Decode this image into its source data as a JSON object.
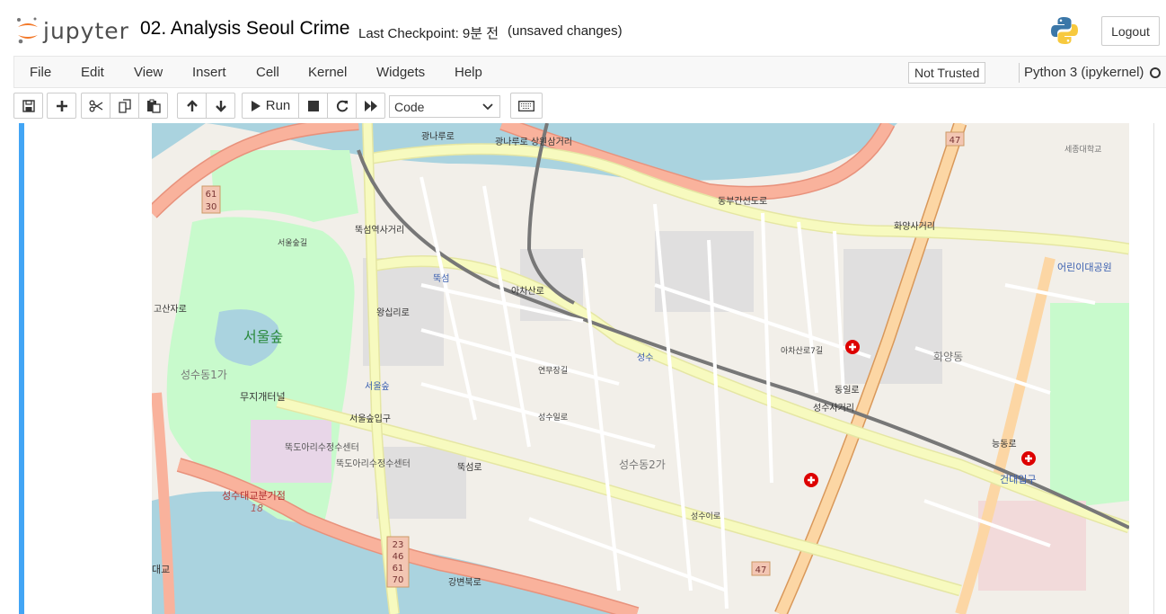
{
  "header": {
    "logo_text": "jupyter",
    "notebook_name": "02. Analysis Seoul Crime",
    "checkpoint": "Last Checkpoint: 9분 전",
    "autosave_status": "(unsaved changes)",
    "logout_label": "Logout"
  },
  "menubar": {
    "items": [
      "File",
      "Edit",
      "View",
      "Insert",
      "Cell",
      "Kernel",
      "Widgets",
      "Help"
    ],
    "trust_status": "Not Trusted",
    "kernel_name": "Python 3 (ipykernel)"
  },
  "toolbar": {
    "run_label": "Run",
    "cell_type": "Code",
    "cell_type_options": [
      "Code"
    ],
    "icons": [
      "save-icon",
      "plus-icon",
      "cut-icon",
      "copy-icon",
      "paste-icon",
      "arrow-up-icon",
      "arrow-down-icon",
      "play-icon",
      "stop-icon",
      "restart-icon",
      "fast-forward-icon",
      "keyboard-icon"
    ]
  },
  "colors": {
    "cell_selected_bar": "#42a5f5",
    "map_land": "#f2efe9",
    "map_water": "#aad3df",
    "map_park": "#c8facc",
    "map_primary_road": "#fcd6a4",
    "map_trunk_road": "#f9b29c",
    "map_secondary_road": "#f7fabf"
  },
  "map": {
    "place_labels": [
      "서울숲",
      "성수동1가",
      "성수동2가",
      "화양동",
      "뚝섬",
      "성수",
      "서울숲",
      "건대입구",
      "어린이대공원",
      "세종대학교",
      "뚝도아리수정수센터",
      "뚝도아리수정수센터",
      "성수대교분기점",
      "대교",
      "서울숲길",
      "무지개터널",
      "뚝섬역사거리",
      "서울숲입구",
      "화양사거리",
      "성수사거리"
    ],
    "road_labels": [
      "광나루로",
      "동부간선도로",
      "아차산로",
      "뚝섬로",
      "강변북로",
      "동일로",
      "능동로",
      "왕십리로",
      "광나루로 상원삼거리",
      "고산자로",
      "연무장길",
      "성수이로",
      "아차산로7길",
      "성수일로"
    ],
    "route_shields": [
      "61",
      "30",
      "47",
      "47",
      "23",
      "46",
      "61",
      "70",
      "18"
    ]
  }
}
